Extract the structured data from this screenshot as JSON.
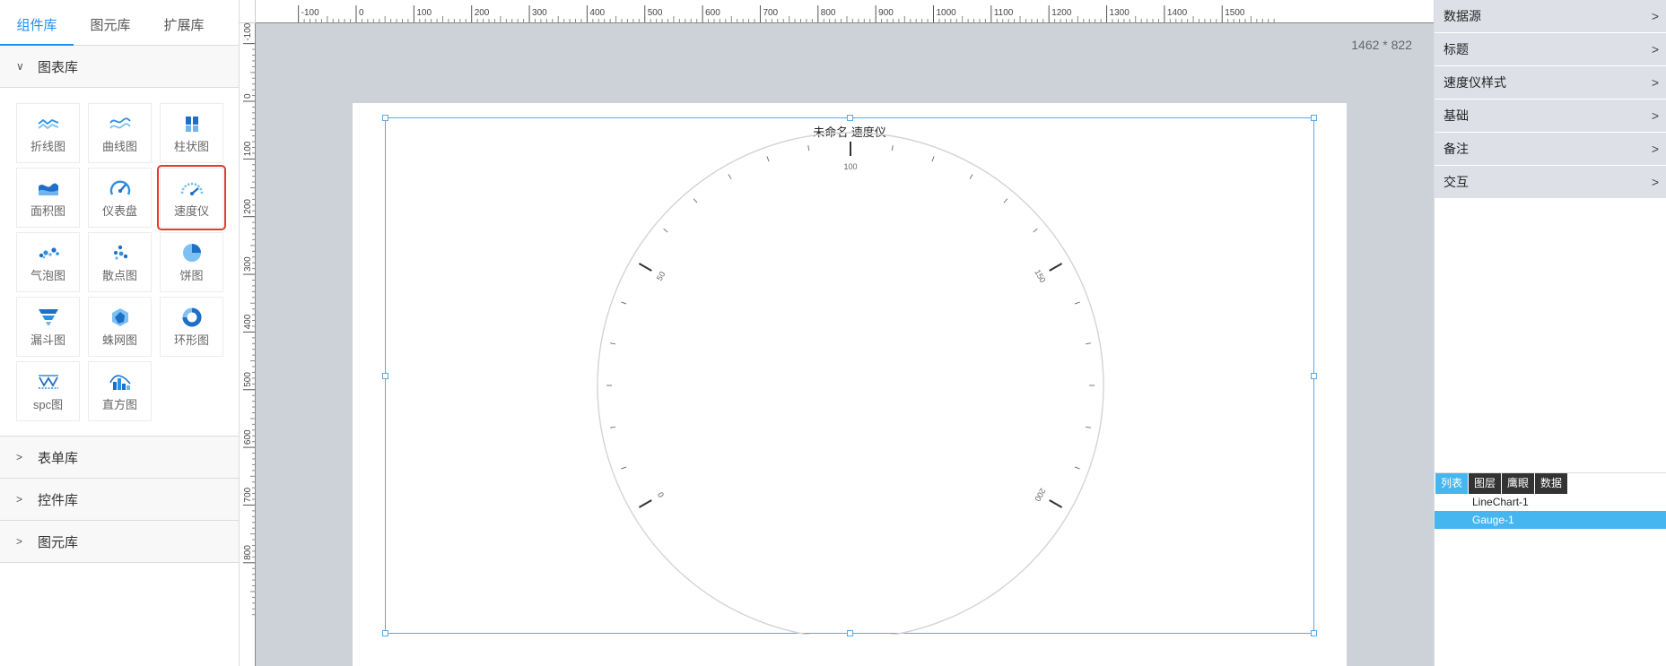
{
  "left_panel": {
    "tabs": [
      {
        "label": "组件库",
        "active": true
      },
      {
        "label": "图元库",
        "active": false
      },
      {
        "label": "扩展库",
        "active": false
      }
    ],
    "sections": {
      "chart_lib": {
        "label": "图表库",
        "expanded": true
      },
      "form_lib": {
        "label": "表单库",
        "expanded": false
      },
      "control_lib": {
        "label": "控件库",
        "expanded": false
      },
      "element_lib": {
        "label": "图元库",
        "expanded": false
      }
    },
    "chart_items": [
      {
        "label": "折线图",
        "icon": "line-chart-icon"
      },
      {
        "label": "曲线图",
        "icon": "curve-chart-icon"
      },
      {
        "label": "柱状图",
        "icon": "bar-chart-icon"
      },
      {
        "label": "面积图",
        "icon": "area-chart-icon"
      },
      {
        "label": "仪表盘",
        "icon": "dashboard-icon"
      },
      {
        "label": "速度仪",
        "icon": "speedometer-icon",
        "selected": true
      },
      {
        "label": "气泡图",
        "icon": "bubble-chart-icon"
      },
      {
        "label": "散点图",
        "icon": "scatter-chart-icon"
      },
      {
        "label": "饼图",
        "icon": "pie-chart-icon"
      },
      {
        "label": "漏斗图",
        "icon": "funnel-chart-icon"
      },
      {
        "label": "蛛网图",
        "icon": "radar-chart-icon"
      },
      {
        "label": "环形图",
        "icon": "donut-chart-icon"
      },
      {
        "label": "spc图",
        "icon": "spc-chart-icon"
      },
      {
        "label": "直方图",
        "icon": "histogram-icon"
      }
    ]
  },
  "rulers": {
    "horizontal": [
      "-100",
      "0",
      "100",
      "200",
      "300",
      "400",
      "500",
      "600",
      "700",
      "800",
      "900",
      "1000",
      "1100",
      "1200",
      "1300",
      "1400",
      "1500"
    ],
    "vertical": [
      "-100",
      "0",
      "100",
      "200",
      "300",
      "400",
      "500",
      "600",
      "700",
      "800"
    ]
  },
  "canvas": {
    "size_label": "1462 * 822",
    "gauge": {
      "title": "未命名 速度仪",
      "scale_labels": [
        "0",
        "50",
        "100",
        "150",
        "200"
      ]
    }
  },
  "right_panel": {
    "properties": [
      {
        "label": "数据源"
      },
      {
        "label": "标题"
      },
      {
        "label": "速度仪样式"
      },
      {
        "label": "基础"
      },
      {
        "label": "备注"
      },
      {
        "label": "交互"
      }
    ],
    "layer_tabs": [
      {
        "label": "列表",
        "active": true
      },
      {
        "label": "图层",
        "active": false
      },
      {
        "label": "鹰眼",
        "active": false
      },
      {
        "label": "数据",
        "active": false
      }
    ],
    "layers": [
      {
        "label": "LineChart-1",
        "active": false
      },
      {
        "label": "Gauge-1",
        "active": true
      }
    ]
  },
  "colors": {
    "accent": "#1f8ef1",
    "selection": "#5aa8e6",
    "highlight_red": "#e53935",
    "layer_active": "#45b6f0",
    "canvas_bg": "#cdd2d9"
  }
}
